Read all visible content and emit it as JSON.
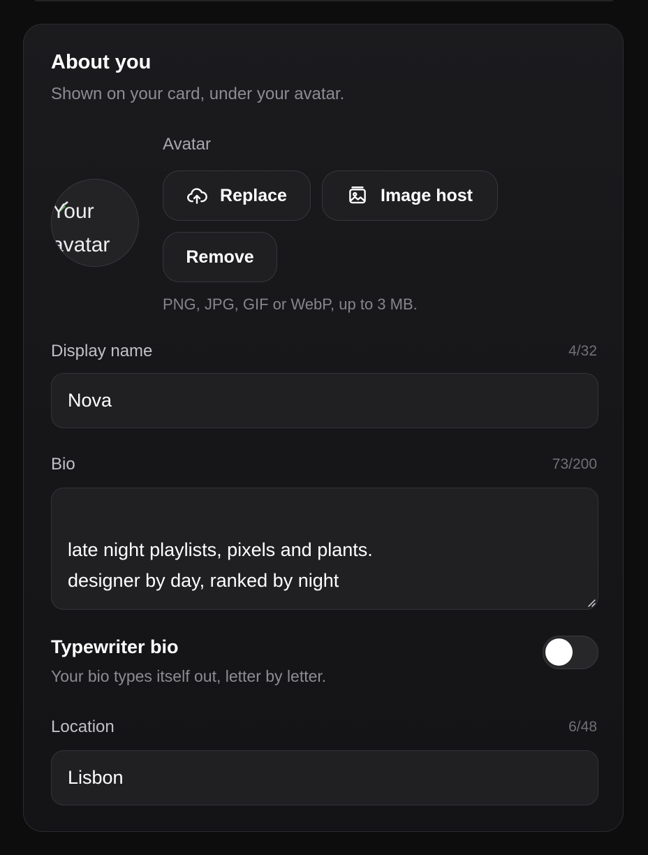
{
  "section": {
    "title": "About you",
    "subtitle": "Shown on your card, under your avatar."
  },
  "avatar": {
    "label": "Avatar",
    "alt_text": "Your avatar",
    "buttons": {
      "replace": "Replace",
      "image_host": "Image host",
      "remove": "Remove"
    },
    "hint": "PNG, JPG, GIF or WebP, up to 3 MB."
  },
  "display_name": {
    "label": "Display name",
    "counter": "4/32",
    "value": "Nova"
  },
  "bio": {
    "label": "Bio",
    "counter": "73/200",
    "value": "late night playlists, pixels and plants.\ndesigner by day, ranked by night"
  },
  "typewriter_bio": {
    "title": "Typewriter bio",
    "description": "Your bio types itself out, letter by letter.",
    "enabled": false
  },
  "location": {
    "label": "Location",
    "counter": "6/48",
    "value": "Lisbon"
  },
  "icons": {
    "replace": "cloud-upload-icon",
    "image_host": "image-icon",
    "avatar_placeholder": "broken-image-icon"
  },
  "colors": {
    "background": "#0d0d0e",
    "card": "#1b1b1e",
    "text": "#ffffff",
    "muted": "#8c8c93",
    "toggle_knob": "#ffffff"
  }
}
